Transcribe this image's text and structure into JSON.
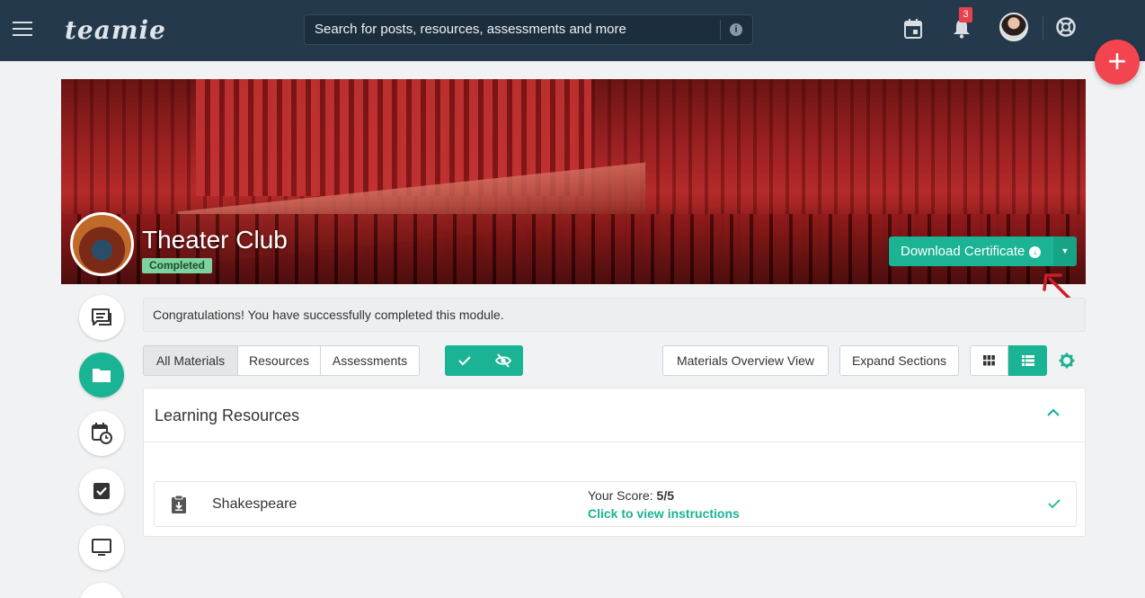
{
  "header": {
    "logo_text": "teamie",
    "search_placeholder": "Search for posts, resources, assessments and more",
    "notification_count": "3"
  },
  "fab": {
    "label": "+"
  },
  "course": {
    "title": "Theater Club",
    "status": "Completed",
    "download_label": "Download Certificate"
  },
  "alert": {
    "message": "Congratulations! You have successfully completed this module."
  },
  "filters": {
    "tabs": [
      {
        "label": "All Materials",
        "active": true
      },
      {
        "label": "Resources",
        "active": false
      },
      {
        "label": "Assessments",
        "active": false
      }
    ],
    "overview_label": "Materials Overview View",
    "expand_label": "Expand Sections"
  },
  "section": {
    "title": "Learning Resources",
    "items": [
      {
        "title": "Shakespeare",
        "score_label": "Your Score: ",
        "score_value": "5/5",
        "link_text": "Click to view instructions"
      }
    ]
  },
  "colors": {
    "primary": "#1ab394",
    "header_bg": "#243a4c",
    "fab": "#f2454f",
    "badge": "#e8414b"
  },
  "icons": {
    "menu": "hamburger-icon",
    "calendar": "calendar-icon",
    "notifications": "bell-icon",
    "help": "lifebuoy-icon",
    "rail": [
      "chat-icon",
      "folder-icon",
      "calendar-clock-icon",
      "checkbox-icon",
      "monitor-icon"
    ]
  }
}
